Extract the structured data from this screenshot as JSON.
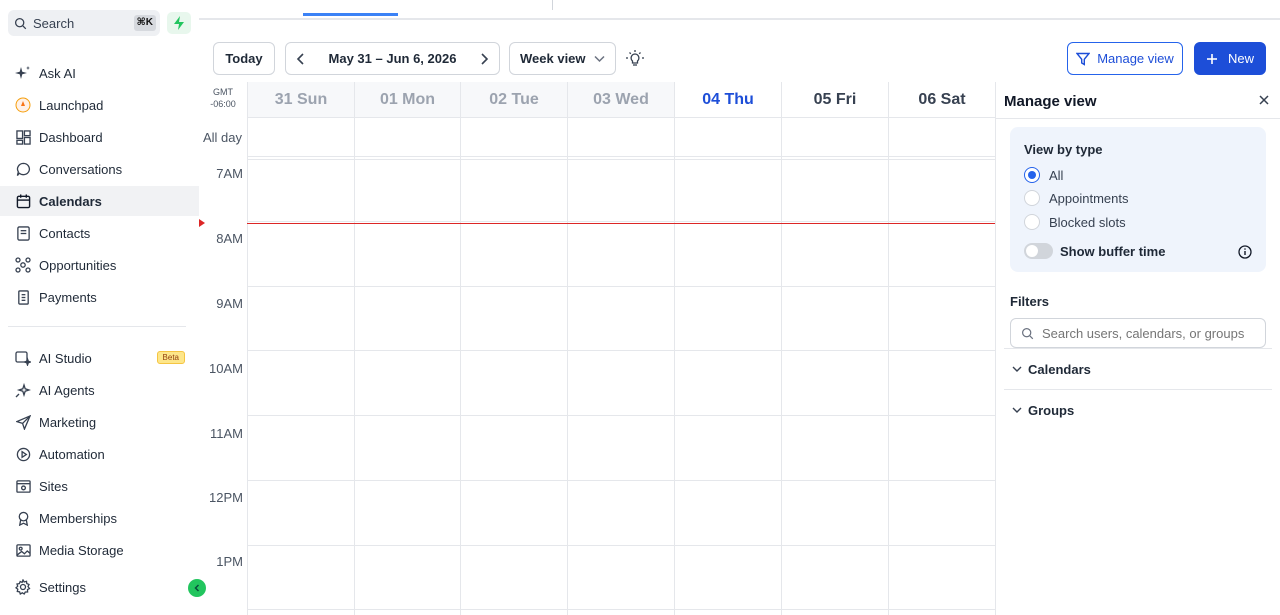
{
  "sidebar": {
    "search_label": "Search",
    "search_shortcut": "⌘K",
    "items_top": [
      {
        "label": "Ask AI",
        "icon": "sparkle-icon"
      },
      {
        "label": "Launchpad",
        "icon": "launchpad-icon"
      },
      {
        "label": "Dashboard",
        "icon": "dashboard-icon"
      },
      {
        "label": "Conversations",
        "icon": "chat-icon"
      },
      {
        "label": "Calendars",
        "icon": "calendar-icon",
        "active": true
      },
      {
        "label": "Contacts",
        "icon": "contacts-icon"
      },
      {
        "label": "Opportunities",
        "icon": "opportunities-icon"
      },
      {
        "label": "Payments",
        "icon": "payments-icon"
      }
    ],
    "items_bottom": [
      {
        "label": "AI Studio",
        "icon": "ai-studio-icon",
        "badge": "Beta"
      },
      {
        "label": "AI Agents",
        "icon": "ai-agents-icon"
      },
      {
        "label": "Marketing",
        "icon": "send-icon"
      },
      {
        "label": "Automation",
        "icon": "automation-icon"
      },
      {
        "label": "Sites",
        "icon": "sites-icon"
      },
      {
        "label": "Memberships",
        "icon": "award-icon"
      },
      {
        "label": "Media Storage",
        "icon": "image-icon"
      }
    ],
    "settings_label": "Settings"
  },
  "toolbar": {
    "today_label": "Today",
    "date_range": "May 31 – Jun 6, 2026",
    "view_select": "Week view",
    "manage_view_label": "Manage view",
    "new_label": "New"
  },
  "calendar": {
    "timezone_line1": "GMT",
    "timezone_line2": "-06:00",
    "all_day_label": "All day",
    "days": [
      {
        "label": "31 Sun",
        "state": "past"
      },
      {
        "label": "01 Mon",
        "state": "past"
      },
      {
        "label": "02 Tue",
        "state": "past"
      },
      {
        "label": "03 Wed",
        "state": "past"
      },
      {
        "label": "04 Thu",
        "state": "today"
      },
      {
        "label": "05 Fri",
        "state": "future"
      },
      {
        "label": "06 Sat",
        "state": "future"
      }
    ],
    "hours": [
      "7AM",
      "8AM",
      "9AM",
      "10AM",
      "11AM",
      "12PM",
      "1PM"
    ]
  },
  "manage_view": {
    "title": "Manage view",
    "view_by_type_title": "View by type",
    "options": [
      {
        "label": "All",
        "selected": true
      },
      {
        "label": "Appointments",
        "selected": false
      },
      {
        "label": "Blocked slots",
        "selected": false
      }
    ],
    "buffer_toggle_label": "Show buffer time",
    "buffer_toggle_on": false,
    "filters_title": "Filters",
    "filter_search_placeholder": "Search users, calendars, or groups",
    "sections": [
      "Calendars",
      "Groups"
    ]
  },
  "colors": {
    "primary": "#1d4ed8",
    "now_line": "#dc2626",
    "accent_green": "#22c55e"
  }
}
